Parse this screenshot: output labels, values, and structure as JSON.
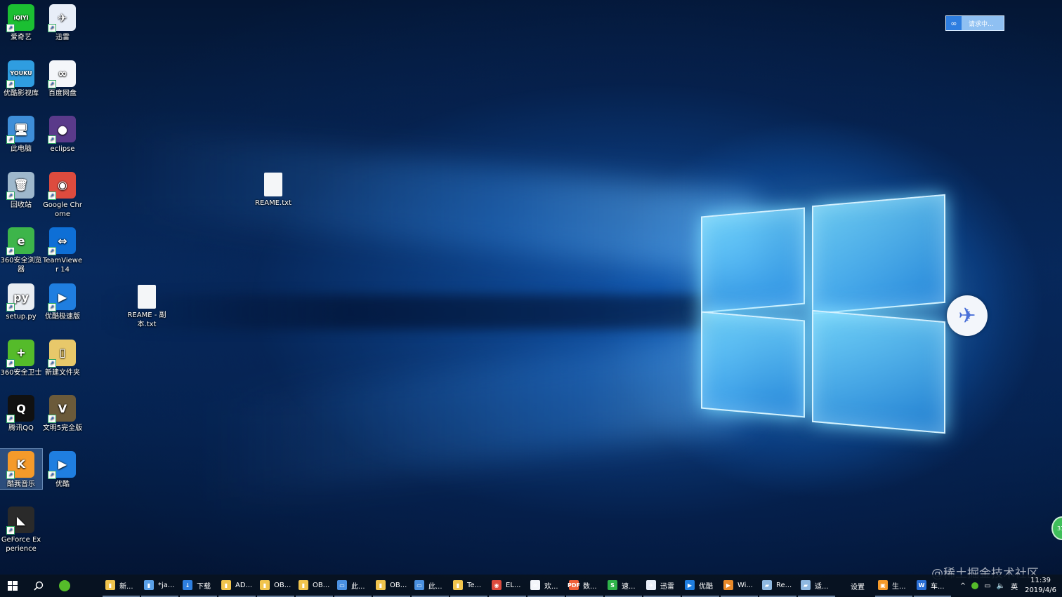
{
  "desktop": {
    "icons": [
      {
        "label": "爱奇艺",
        "glyph": "iQIYI",
        "color": "#1bbf32"
      },
      {
        "label": "迅雷",
        "glyph": "✈",
        "color": "#e8eef8"
      },
      {
        "label": "优酷影视库",
        "glyph": "YOUKU",
        "color": "#2f9de0"
      },
      {
        "label": "百度网盘",
        "glyph": "∞",
        "color": "#f4f6fa"
      },
      {
        "label": "此电脑",
        "glyph": "🖥",
        "color": "#3e8ed8"
      },
      {
        "label": "eclipse",
        "glyph": "●",
        "color": "#5a3a8a"
      },
      {
        "label": "回收站",
        "glyph": "🗑",
        "color": "#9eb8cc"
      },
      {
        "label": "Google Chrome",
        "glyph": "◉",
        "color": "#dd4b3e"
      },
      {
        "label": "360安全浏览器",
        "glyph": "e",
        "color": "#3db54a"
      },
      {
        "label": "TeamViewer 14",
        "glyph": "⇔",
        "color": "#0e6fd6"
      },
      {
        "label": "setup.py",
        "glyph": "py",
        "color": "#e9edf2"
      },
      {
        "label": "优酷极速版",
        "glyph": "▶",
        "color": "#1f7ee0"
      },
      {
        "label": "360安全卫士",
        "glyph": "+",
        "color": "#55bb2a"
      },
      {
        "label": "新建文件夹",
        "glyph": "▯",
        "color": "#e8c86a"
      },
      {
        "label": "腾讯QQ",
        "glyph": "Q",
        "color": "#111111"
      },
      {
        "label": "文明5完全版",
        "glyph": "Ⅴ",
        "color": "#6b5a3a"
      },
      {
        "label": "酷我音乐",
        "glyph": "K",
        "color": "#f59a2a"
      },
      {
        "label": "优酷",
        "glyph": "▶",
        "color": "#1f7ee0"
      },
      {
        "label": "GeForce Experience",
        "glyph": "◣",
        "color": "#2a2a2a"
      }
    ],
    "files": [
      {
        "label": "REAME.txt"
      },
      {
        "label": "REAME - 副本.txt"
      }
    ]
  },
  "floating": {
    "baidu_status": "请求中...",
    "green_badge": "31"
  },
  "watermark": "@稀土掘金技术社区",
  "taskbar": {
    "apps": [
      {
        "label": "新...",
        "glyph": "▮",
        "color": "#f1c44d"
      },
      {
        "label": "*ja...",
        "glyph": "▮",
        "color": "#5aa0e8"
      },
      {
        "label": "下载",
        "glyph": "↓",
        "color": "#2e7fe0"
      },
      {
        "label": "AD...",
        "glyph": "▮",
        "color": "#f1c44d"
      },
      {
        "label": "OB...",
        "glyph": "▮",
        "color": "#f1c44d"
      },
      {
        "label": "OB...",
        "glyph": "▮",
        "color": "#f1c44d"
      },
      {
        "label": "此...",
        "glyph": "▭",
        "color": "#4a90e0"
      },
      {
        "label": "OB...",
        "glyph": "▮",
        "color": "#f1c44d"
      },
      {
        "label": "此...",
        "glyph": "▭",
        "color": "#4a90e0"
      },
      {
        "label": "Te...",
        "glyph": "▮",
        "color": "#f1c44d"
      },
      {
        "label": "EL...",
        "glyph": "◉",
        "color": "#dd4b3e"
      },
      {
        "label": "欢...",
        "glyph": "∞",
        "color": "#f4f6fa"
      },
      {
        "label": "数...",
        "glyph": "PDF",
        "color": "#f0603a"
      },
      {
        "label": "速...",
        "glyph": "S",
        "color": "#2fb34a"
      },
      {
        "label": "迅雷",
        "glyph": "✈",
        "color": "#e8eef8"
      },
      {
        "label": "优酷",
        "glyph": "▶",
        "color": "#1f7ee0"
      },
      {
        "label": "Wi...",
        "glyph": "▶",
        "color": "#e8892a"
      },
      {
        "label": "Re...",
        "glyph": "▰",
        "color": "#8fb8e0"
      },
      {
        "label": "适...",
        "glyph": "▰",
        "color": "#8fb8e0"
      },
      {
        "label": "设置",
        "glyph": "",
        "color": "transparent"
      },
      {
        "label": "生...",
        "glyph": "▣",
        "color": "#f59a2a"
      },
      {
        "label": "车...",
        "glyph": "W",
        "color": "#2a6fd6"
      }
    ],
    "tray": {
      "chevron": "^",
      "volume": "🔈",
      "ime": "英",
      "time": "11:39",
      "date": "2019/4/6"
    }
  }
}
